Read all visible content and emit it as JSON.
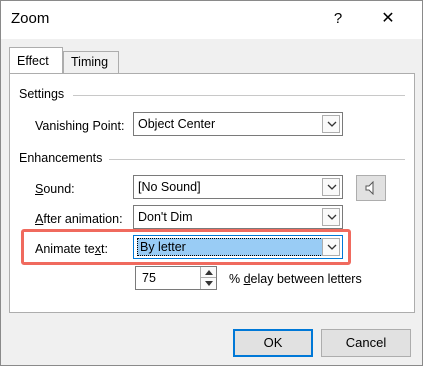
{
  "window": {
    "title": "Zoom",
    "help_glyph": "?",
    "close_glyph": "✕"
  },
  "tabs": [
    {
      "label": "Effect",
      "active": true
    },
    {
      "label": "Timing",
      "active": false
    }
  ],
  "settings": {
    "group_label": "Settings",
    "vanishing_point": {
      "label": "Vanishing Point:",
      "value": "Object Center"
    }
  },
  "enhancements": {
    "group_label": "Enhancements",
    "sound": {
      "label_u": "S",
      "label_rest": "ound:",
      "value": "[No Sound]"
    },
    "after_animation": {
      "label_u": "A",
      "label_rest": "fter animation:",
      "value": "Don't Dim"
    },
    "animate_text": {
      "label_pre": "Animate te",
      "label_u": "x",
      "label_rest": "t:",
      "value": "By letter"
    },
    "delay": {
      "value": "75",
      "label_pre": "% ",
      "label_u": "d",
      "label_rest": "elay between letters"
    }
  },
  "buttons": {
    "ok": "OK",
    "cancel": "Cancel"
  },
  "colors": {
    "highlight_border": "#f06a5e",
    "selection": "#99ccf5",
    "focus_accent": "#0078d7"
  }
}
